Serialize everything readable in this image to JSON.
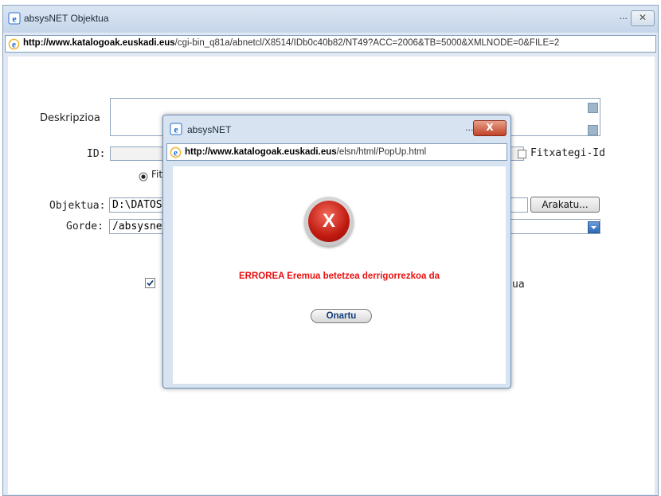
{
  "outer_window": {
    "title": "absysNET Objektua",
    "url_host": "http://www.katalogoak.euskadi.eus",
    "url_path": "/cgi-bin_q81a/abnetcl/X8514/IDb0c40b82/NT49?ACC=2006&TB=5000&XMLNODE=0&FILE=2",
    "minimize_label": "...",
    "close_label": "✕"
  },
  "form": {
    "description_label": "Deskripzioa",
    "id_label": "ID:",
    "file_id_label": "Fitxategi-Id",
    "file_id_checked": false,
    "radio_label": "Fit",
    "object_label": "Objektua:",
    "object_value": "D:\\DATOS",
    "browse_button": "Arakatu...",
    "save_label": "Gorde:",
    "save_value": "/absysnet",
    "checkbox_checked": true,
    "checkbox_suffix": "ua"
  },
  "popup": {
    "title": "absysNET",
    "url_host": "http://www.katalogoak.euskadi.eus",
    "url_path": "/elsn/html/PopUp.html",
    "minimize_label": "...",
    "close_label": "X",
    "error_icon_letter": "X",
    "error_message": "ERROREA Eremua betetzea derrigorrezkoa da",
    "ok_button": "Onartu"
  }
}
